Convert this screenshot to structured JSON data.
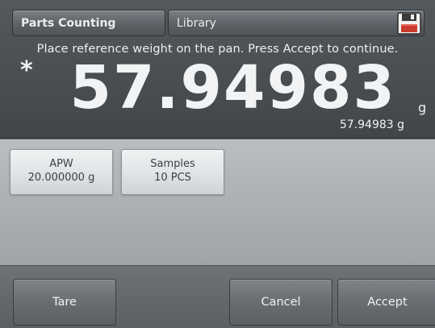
{
  "header": {
    "mode_tab": "Parts Counting",
    "library_tab": "Library",
    "save_icon": "save-icon"
  },
  "display": {
    "instruction": "Place reference weight on the pan.  Press Accept to continue.",
    "stability_indicator": "*",
    "main_weight": "57.94983",
    "main_unit": "g",
    "secondary_weight": "57.94983 g"
  },
  "params": {
    "apw_label": "APW",
    "apw_value": "20.000000 g",
    "samples_label": "Samples",
    "samples_value": "10 PCS"
  },
  "actions": {
    "tare_label": "Tare",
    "cancel_label": "Cancel",
    "accept_label": "Accept"
  }
}
